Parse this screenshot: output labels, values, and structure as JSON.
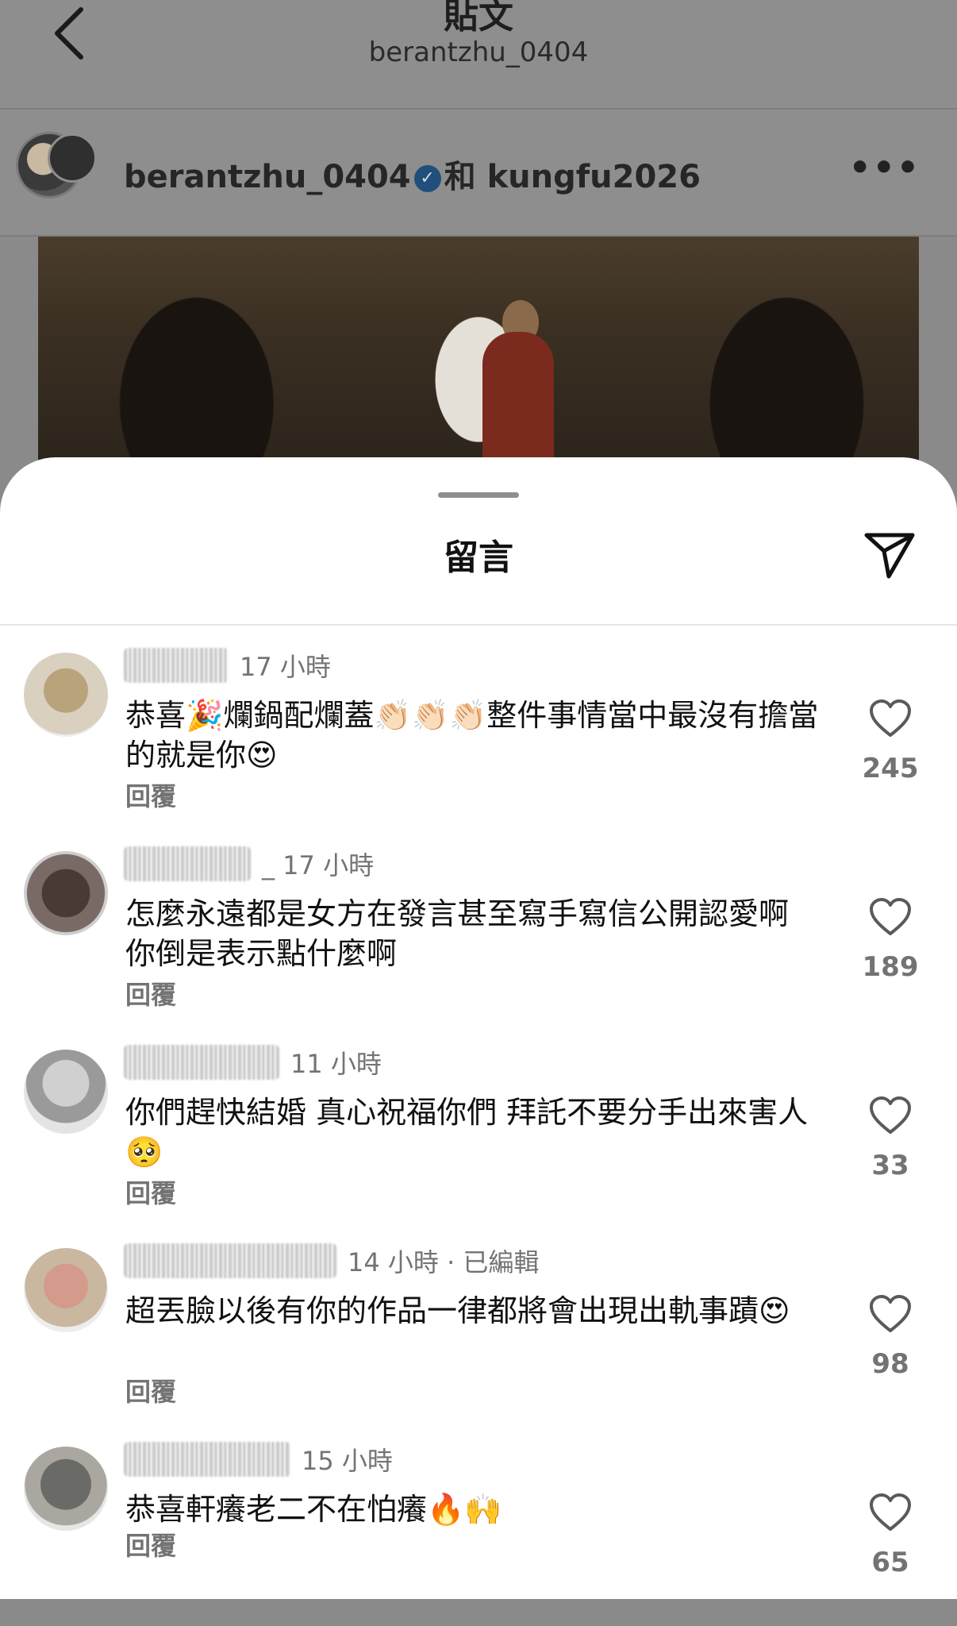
{
  "header": {
    "title": "貼文",
    "subtitle": "berantzhu_0404"
  },
  "post": {
    "author": "berantzhu_0404",
    "conjunction": "和",
    "collaborator": "kungfu2026",
    "more": "•••"
  },
  "sheet": {
    "title": "留言"
  },
  "comments": [
    {
      "time": "17 小時",
      "text": "恭喜🎉爛鍋配爛蓋👏🏻👏🏻👏🏻整件事情當中最沒有擔當的就是你😍",
      "reply": "回覆",
      "likes": "245"
    },
    {
      "time": "_ 17 小時",
      "text": "怎麼永遠都是女方在發言甚至寫手寫信公開認愛啊 你倒是表示點什麼啊",
      "reply": "回覆",
      "likes": "189"
    },
    {
      "time": "11 小時",
      "text": "你們趕快結婚 真心祝福你們 拜託不要分手出來害人🥺",
      "reply": "回覆",
      "likes": "33"
    },
    {
      "time": "14 小時 · 已編輯",
      "text": "超丟臉以後有你的作品一律都將會出現出軌事蹟😍",
      "reply": "回覆",
      "likes": "98"
    },
    {
      "time": "15 小時",
      "text": "恭喜軒癢老二不在怕癢🔥🙌",
      "reply": "回覆",
      "likes": "65"
    }
  ],
  "icons": {
    "back": "chevron-left-icon",
    "share": "paper-plane-icon",
    "like": "heart-outline-icon",
    "verified": "verified-badge-icon"
  },
  "colors": {
    "verified_badge": "#1f4f7a",
    "muted_text": "#737373"
  }
}
